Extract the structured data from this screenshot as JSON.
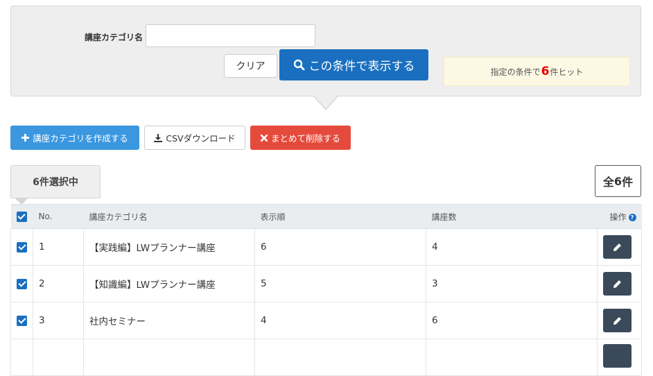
{
  "search": {
    "field_label": "講座カテゴリ名",
    "field_value": "",
    "field_placeholder": "",
    "clear_label": "クリア",
    "search_label": "この条件で表示する",
    "search_icon": "search-icon",
    "hit_prefix": "指定の条件で",
    "hit_count": "6",
    "hit_suffix": "件ヒット"
  },
  "actions": {
    "create_label": "講座カテゴリを作成する",
    "create_icon": "plus-icon",
    "csv_label": "CSVダウンロード",
    "csv_icon": "download-icon",
    "delete_label": "まとめて削除する",
    "delete_icon": "times-icon"
  },
  "selection": {
    "selected_label": "6件選択中",
    "total_prefix": "全",
    "total_count": "6",
    "total_suffix": "件"
  },
  "table": {
    "headers": {
      "no": "No.",
      "name": "講座カテゴリ名",
      "order": "表示順",
      "count": "講座数",
      "ops": "操作"
    },
    "rows": [
      {
        "no": "1",
        "name": "【実践編】LWプランナー講座",
        "order": "6",
        "count": "4"
      },
      {
        "no": "2",
        "name": "【知識編】LWプランナー講座",
        "order": "5",
        "count": "3"
      },
      {
        "no": "3",
        "name": "社内セミナー",
        "order": "4",
        "count": "6"
      },
      {
        "no": "",
        "name": "",
        "order": "",
        "count": ""
      }
    ]
  },
  "colors": {
    "primary": "#1a6fc0",
    "create": "#3a97e0",
    "delete": "#e54b3c",
    "hit_count": "#e40000",
    "edit_button": "#3b4a5a"
  }
}
